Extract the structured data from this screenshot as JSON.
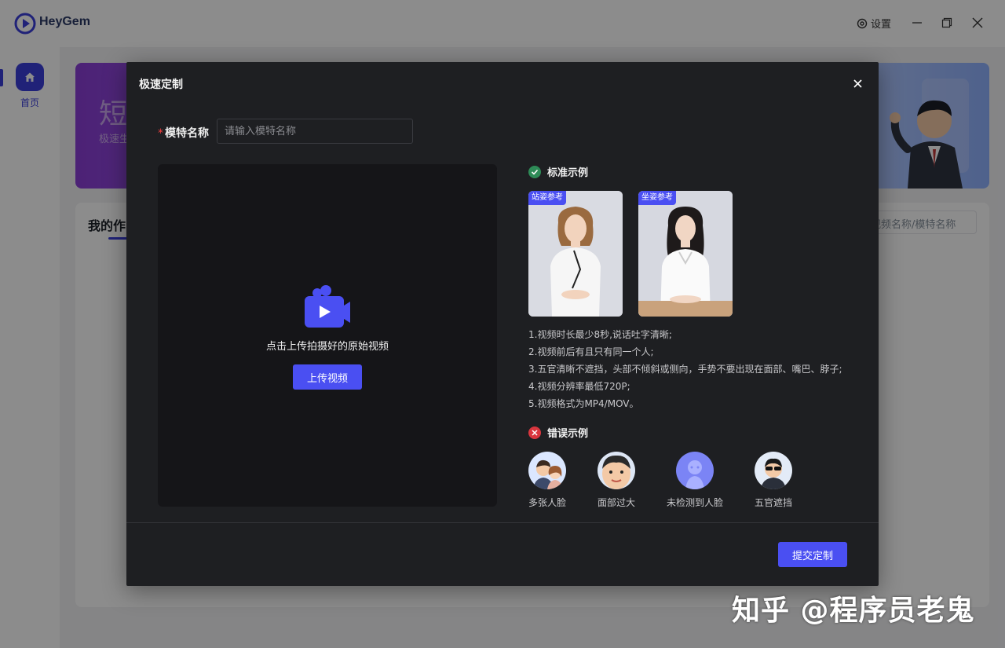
{
  "app": {
    "name": "HeyGem",
    "settings_label": "设置"
  },
  "sidebar": {
    "items": [
      {
        "label": "首页",
        "icon": "home-icon"
      }
    ]
  },
  "banner": {
    "title": "短",
    "subtitle": "极速生"
  },
  "works": {
    "title": "我的作",
    "search_placeholder": "视频名称/模特名称"
  },
  "modal": {
    "title": "极速定制",
    "name_field": {
      "label": "模特名称",
      "required_mark": "*",
      "placeholder": "请输入模特名称",
      "value": ""
    },
    "upload": {
      "prompt": "点击上传拍摄好的原始视频",
      "button_label": "上传视频"
    },
    "good_examples": {
      "title": "标准示例",
      "cards": [
        {
          "tag": "站姿参考"
        },
        {
          "tag": "坐姿参考"
        }
      ],
      "rules": [
        "1.视频时长最少8秒,说话吐字清晰;",
        "2.视频前后有且只有同一个人;",
        "3.五官清晰不遮挡，头部不倾斜或侧向，手势不要出现在面部、嘴巴、脖子;",
        "4.视频分辨率最低720P;",
        "5.视频格式为MP4/MOV。"
      ]
    },
    "bad_examples": {
      "title": "错误示例",
      "items": [
        {
          "label": "多张人脸"
        },
        {
          "label": "面部过大"
        },
        {
          "label": "未检测到人脸"
        },
        {
          "label": "五官遮挡"
        }
      ]
    },
    "submit_label": "提交定制"
  },
  "watermark": "知乎 @程序员老鬼",
  "colors": {
    "accent": "#4a4ff2",
    "modal_bg": "#1e1f22",
    "upload_bg": "#151518",
    "success": "#2e8b57",
    "error": "#d9363e"
  }
}
